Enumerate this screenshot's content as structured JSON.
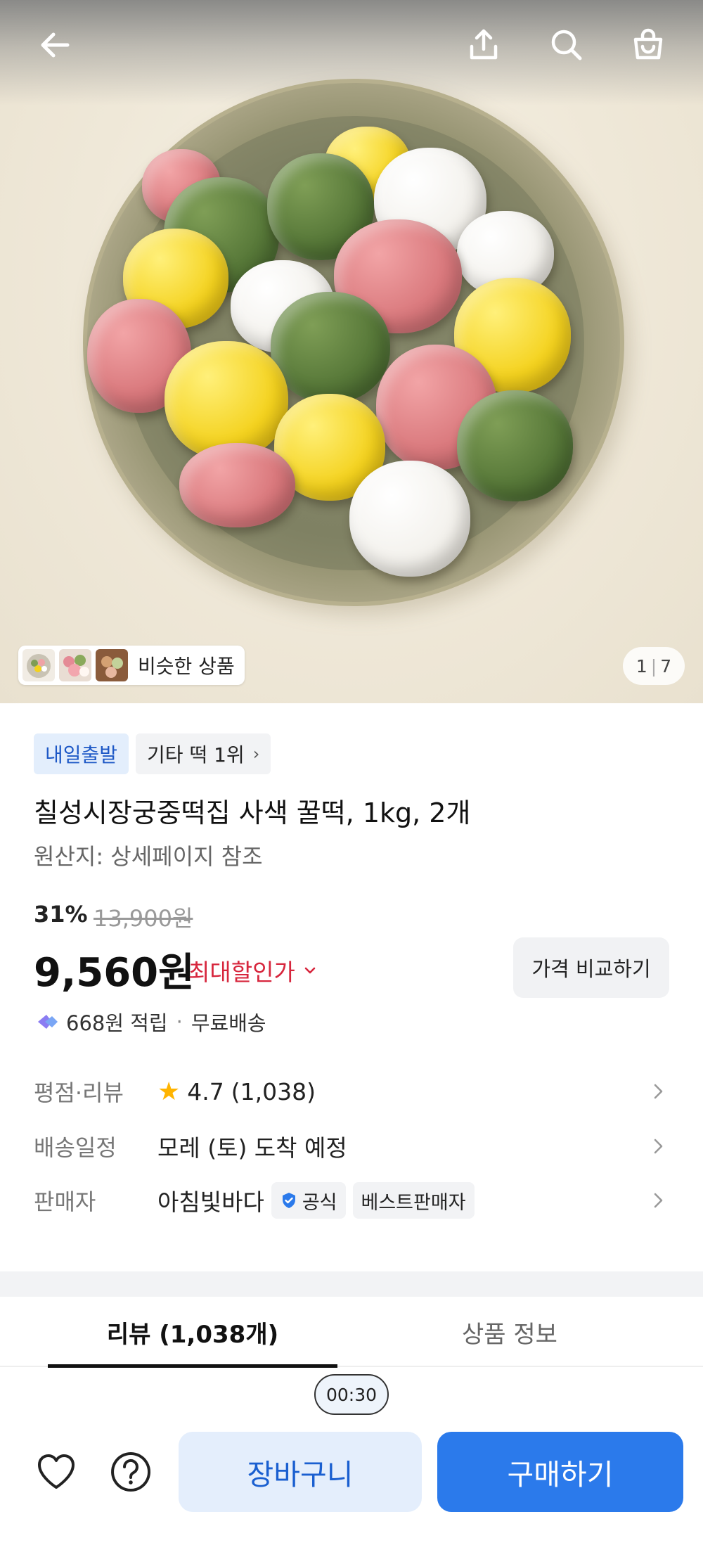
{
  "header": {
    "back_icon": "arrow-left-icon",
    "share_icon": "share-icon",
    "search_icon": "search-icon",
    "cart_icon": "shopping-bag-icon"
  },
  "gallery": {
    "similar_label": "비슷한 상품",
    "current": "1",
    "total": "7"
  },
  "badges": {
    "delivery": "내일출발",
    "rank": "기타 떡 1위"
  },
  "product": {
    "title": "칠성시장궁중떡집 사색 꿀떡, 1kg, 2개",
    "origin": "원산지: 상세페이지 참조",
    "discount": "31%",
    "original_price": "13,900원",
    "price": "9,560원",
    "max_discount_label": "최대할인가",
    "compare_label": "가격 비교하기",
    "reward": "668원 적립",
    "shipping": "무료배송"
  },
  "details": {
    "rating_label": "평점·리뷰",
    "rating": "4.7",
    "rating_count": "(1,038)",
    "delivery_label": "배송일정",
    "delivery_value": "모레 (토) 도착 예정",
    "seller_label": "판매자",
    "seller_name": "아침빛바다",
    "official_label": "공식",
    "best_seller_label": "베스트판매자"
  },
  "tabs": {
    "reviews": "리뷰 (1,038개)",
    "info": "상품 정보"
  },
  "timer": "00:30",
  "bottom": {
    "wishlist_icon": "heart-icon",
    "help_icon": "question-icon",
    "cart_label": "장바구니",
    "buy_label": "구매하기"
  },
  "colors": {
    "accent_blue": "#2b7aeb",
    "discount_red": "#d7263d",
    "star": "#ffb400"
  }
}
